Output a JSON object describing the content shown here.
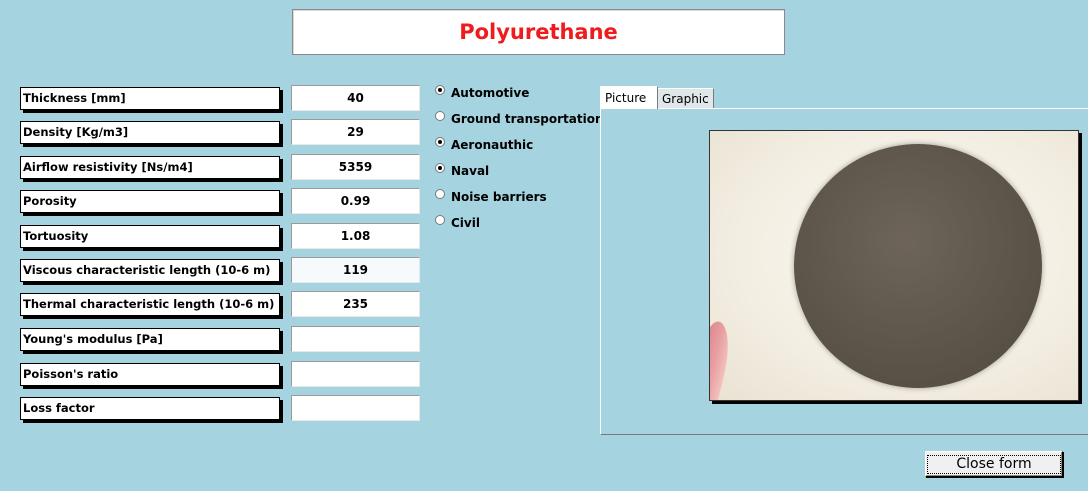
{
  "title": "Polyurethane",
  "properties": [
    {
      "label": "Thickness [mm]",
      "value": "40"
    },
    {
      "label": "Density [Kg/m3]",
      "value": "29"
    },
    {
      "label": "Airflow resistivity [Ns/m4]",
      "value": "5359"
    },
    {
      "label": "Porosity",
      "value": "0.99"
    },
    {
      "label": "Tortuosity",
      "value": "1.08"
    },
    {
      "label": "Viscous characteristic length (10-6 m)",
      "value": "119"
    },
    {
      "label": "Thermal characteristic length (10-6 m)",
      "value": "235"
    },
    {
      "label": "Young's modulus [Pa]",
      "value": ""
    },
    {
      "label": "Poisson's ratio",
      "value": ""
    },
    {
      "label": "Loss factor",
      "value": ""
    }
  ],
  "applications": [
    {
      "label": "Automotive",
      "selected": true
    },
    {
      "label": "Ground transportation",
      "selected": false
    },
    {
      "label": "Aeronauthic",
      "selected": true
    },
    {
      "label": "Naval",
      "selected": true
    },
    {
      "label": "Noise barriers",
      "selected": false
    },
    {
      "label": "Civil",
      "selected": false
    }
  ],
  "tabs": {
    "picture": "Picture",
    "graphic": "Graphic",
    "active": "Picture"
  },
  "close_button": "Close form",
  "colors": {
    "background": "#a6d3e0",
    "title": "#ee1c1c"
  }
}
